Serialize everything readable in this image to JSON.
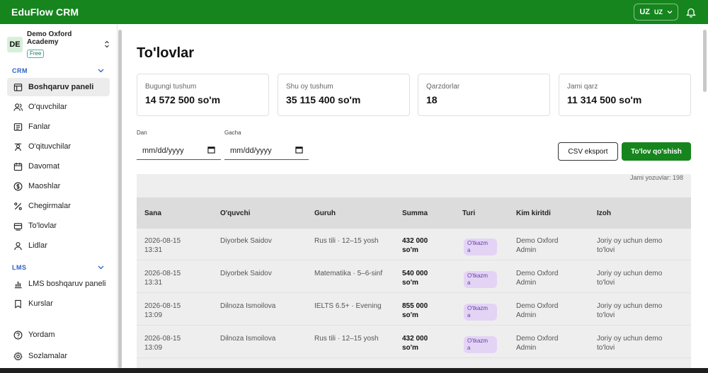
{
  "app": {
    "title": "EduFlow CRM",
    "lang_code": "UZ",
    "lang_sub": "UZ"
  },
  "org": {
    "avatar": "DE",
    "name": "Demo Oxford Academy",
    "plan": "Free"
  },
  "sidebar": {
    "crm_label": "CRM",
    "crm_items": [
      {
        "label": "Boshqaruv paneli",
        "icon": "dashboard-icon"
      },
      {
        "label": "O'quvchilar",
        "icon": "users-icon"
      },
      {
        "label": "Fanlar",
        "icon": "book-icon"
      },
      {
        "label": "O'qituvchilar",
        "icon": "teacher-icon"
      },
      {
        "label": "Davomat",
        "icon": "calendar-icon"
      },
      {
        "label": "Maoshlar",
        "icon": "dollar-icon"
      },
      {
        "label": "Chegirmalar",
        "icon": "percent-icon"
      },
      {
        "label": "To'lovlar",
        "icon": "payments-icon"
      },
      {
        "label": "Lidlar",
        "icon": "leads-icon"
      }
    ],
    "lms_label": "LMS",
    "lms_items": [
      {
        "label": "LMS boshqaruv paneli",
        "icon": "chart-icon"
      },
      {
        "label": "Kurslar",
        "icon": "bookmark-icon"
      }
    ],
    "bottom_items": [
      {
        "label": "Yordam",
        "icon": "help-icon"
      },
      {
        "label": "Sozlamalar",
        "icon": "gear-icon"
      }
    ]
  },
  "page": {
    "title": "To'lovlar",
    "stats": [
      {
        "label": "Bugungi tushum",
        "value": "14 572 500 so'm"
      },
      {
        "label": "Shu oy tushum",
        "value": "35 115 400 so'm"
      },
      {
        "label": "Qarzdorlar",
        "value": "18"
      },
      {
        "label": "Jami qarz",
        "value": "11 314 500 so'm"
      }
    ],
    "filters": {
      "from_label": "Dan",
      "to_label": "Gacha",
      "from_placeholder": "mm/dd/yyyy",
      "to_placeholder": "mm/dd/yyyy"
    },
    "export_button": "CSV eksport",
    "add_button": "To'lov qo'shish",
    "total_records": "Jami yozuvlar: 198",
    "columns": [
      "Sana",
      "O'quvchi",
      "Guruh",
      "Summa",
      "Turi",
      "Kim kiritdi",
      "Izoh"
    ],
    "rows": [
      {
        "date": "2026-08-15",
        "time": "13:31",
        "student": "Diyorbek Saidov",
        "group": "Rus tili · 12–15 yosh",
        "amount1": "432 000",
        "amount2": "so'm",
        "type1": "O'tkazm",
        "type2": "a",
        "by1": "Demo Oxford",
        "by2": "Admin",
        "note1": "Joriy oy uchun demo",
        "note2": "to'lovi"
      },
      {
        "date": "2026-08-15",
        "time": "13:31",
        "student": "Diyorbek Saidov",
        "group": "Matematika · 5–6-sinf",
        "amount1": "540 000",
        "amount2": "so'm",
        "type1": "O'tkazm",
        "type2": "a",
        "by1": "Demo Oxford",
        "by2": "Admin",
        "note1": "Joriy oy uchun demo",
        "note2": "to'lovi"
      },
      {
        "date": "2026-08-15",
        "time": "13:09",
        "student": "Dilnoza Ismoilova",
        "group": "IELTS 6.5+ · Evening",
        "amount1": "855 000",
        "amount2": "so'm",
        "type1": "O'tkazm",
        "type2": "a",
        "by1": "Demo Oxford",
        "by2": "Admin",
        "note1": "Joriy oy uchun demo",
        "note2": "to'lovi"
      },
      {
        "date": "2026-08-15",
        "time": "13:09",
        "student": "Dilnoza Ismoilova",
        "group": "Rus tili · 12–15 yosh",
        "amount1": "432 000",
        "amount2": "so'm",
        "type1": "O'tkazm",
        "type2": "a",
        "by1": "Demo Oxford",
        "by2": "Admin",
        "note1": "Joriy oy uchun demo",
        "note2": "to'lovi"
      }
    ]
  },
  "colors": {
    "brand": "#16851e",
    "badge_bg": "#e3d4f5",
    "badge_text": "#6b3aa6",
    "section": "#2b5fc6"
  }
}
